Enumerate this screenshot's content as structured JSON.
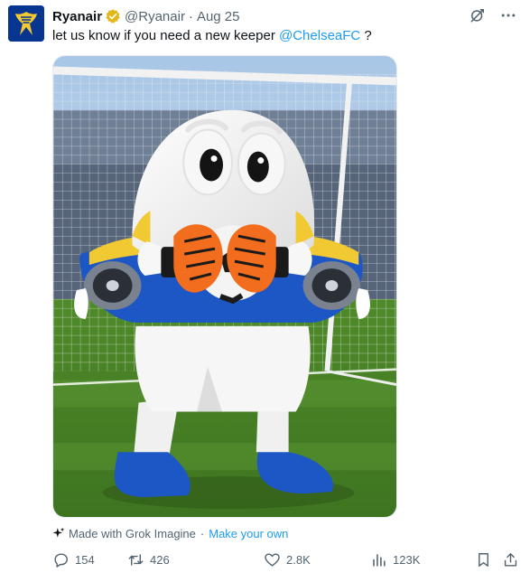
{
  "tweet": {
    "display_name": "Ryanair",
    "verified_icon": "verified-badge-gold",
    "handle": "@Ryanair",
    "separator": "·",
    "date": "Aug 25",
    "text_before": "let us know if you need a new keeper ",
    "mention": "@ChelseaFC",
    "text_after": " ?"
  },
  "media": {
    "kind": "image",
    "subject": "mascot-goalkeeper"
  },
  "made_with": {
    "icon": "sparkle-icon",
    "label": "Made with Grok Imagine",
    "separator": "·",
    "link_label": "Make your own"
  },
  "actions": {
    "reply_count": "154",
    "retweet_count": "426",
    "like_count": "2.8K",
    "views_count": "123K"
  },
  "colors": {
    "link": "#1d9bf0",
    "text": "#0f1419",
    "muted": "#536471",
    "brand_navy": "#073590",
    "brand_yellow": "#f1c933"
  }
}
